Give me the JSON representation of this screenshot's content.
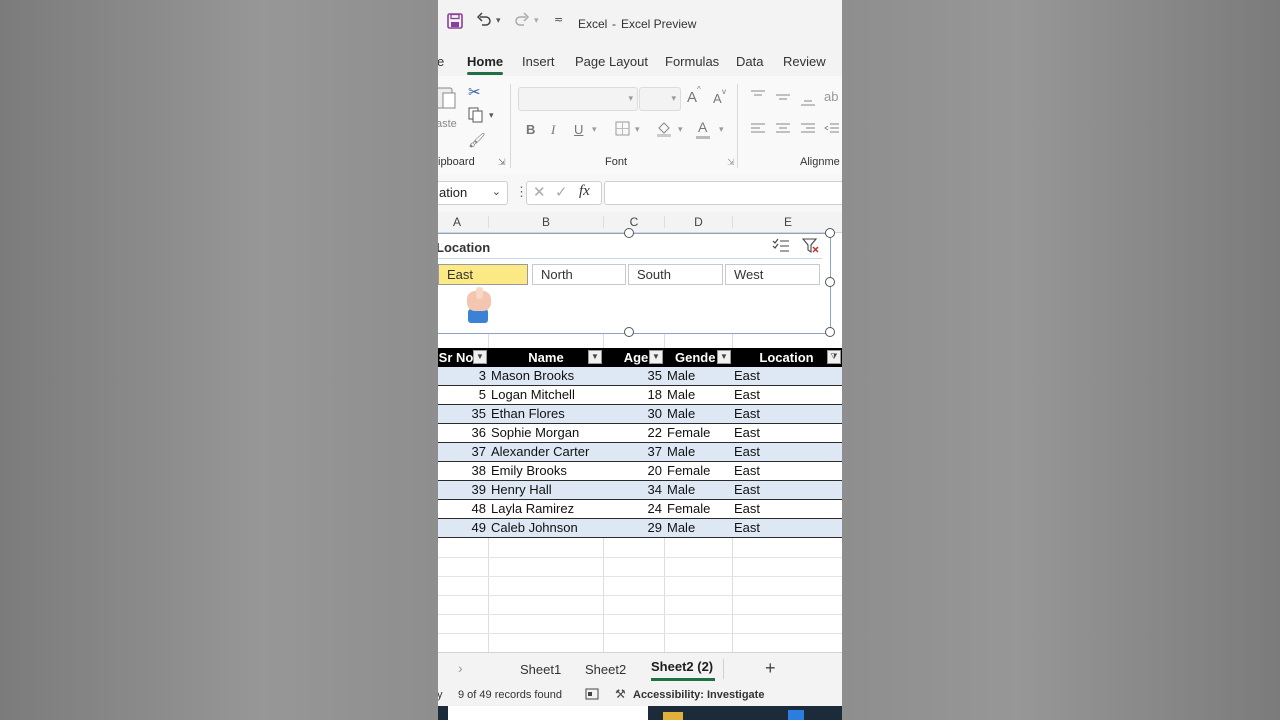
{
  "titlebar": {
    "app_name": "Excel",
    "separator": "-",
    "window_title": "Excel Preview"
  },
  "tabs": [
    "e",
    "Home",
    "Insert",
    "Page Layout",
    "Formulas",
    "Data",
    "Review"
  ],
  "ribbon": {
    "paste_label": "aste",
    "clipboard_label": "ipboard",
    "font_label": "Font",
    "alignment_label": "Alignme",
    "bold": "B",
    "italic": "I",
    "underline": "U",
    "grow_font": "A",
    "shrink_font": "A"
  },
  "formula_bar": {
    "name_box": "ation",
    "fx": "fx",
    "formula": ""
  },
  "columns": [
    "A",
    "B",
    "C",
    "D",
    "E"
  ],
  "slicer": {
    "title": "Location",
    "items": [
      "East",
      "North",
      "South",
      "West"
    ],
    "selected": "East"
  },
  "table": {
    "headers": [
      "Sr No",
      "Name",
      "Age",
      "Gender",
      "Location"
    ],
    "rows": [
      [
        "3",
        "Mason Brooks",
        "35",
        "Male",
        "East"
      ],
      [
        "5",
        "Logan Mitchell",
        "18",
        "Male",
        "East"
      ],
      [
        "35",
        "Ethan Flores",
        "30",
        "Male",
        "East"
      ],
      [
        "36",
        "Sophie Morgan",
        "22",
        "Female",
        "East"
      ],
      [
        "37",
        "Alexander Carter",
        "37",
        "Male",
        "East"
      ],
      [
        "38",
        "Emily Brooks",
        "20",
        "Female",
        "East"
      ],
      [
        "39",
        "Henry Hall",
        "34",
        "Male",
        "East"
      ],
      [
        "48",
        "Layla Ramirez",
        "24",
        "Female",
        "East"
      ],
      [
        "49",
        "Caleb Johnson",
        "29",
        "Male",
        "East"
      ]
    ]
  },
  "sheets": {
    "tabs": [
      "Sheet1",
      "Sheet2",
      "Sheet2 (2)"
    ],
    "active": "Sheet2 (2)",
    "add_label": "+"
  },
  "status": {
    "ready": "y",
    "records": "9 of 49 records found",
    "accessibility": "Accessibility: Investigate"
  },
  "colors": {
    "accent": "#1e7145",
    "slicer_selected": "#fbe985",
    "band": "#dde8f4",
    "header_bg": "#000000"
  }
}
